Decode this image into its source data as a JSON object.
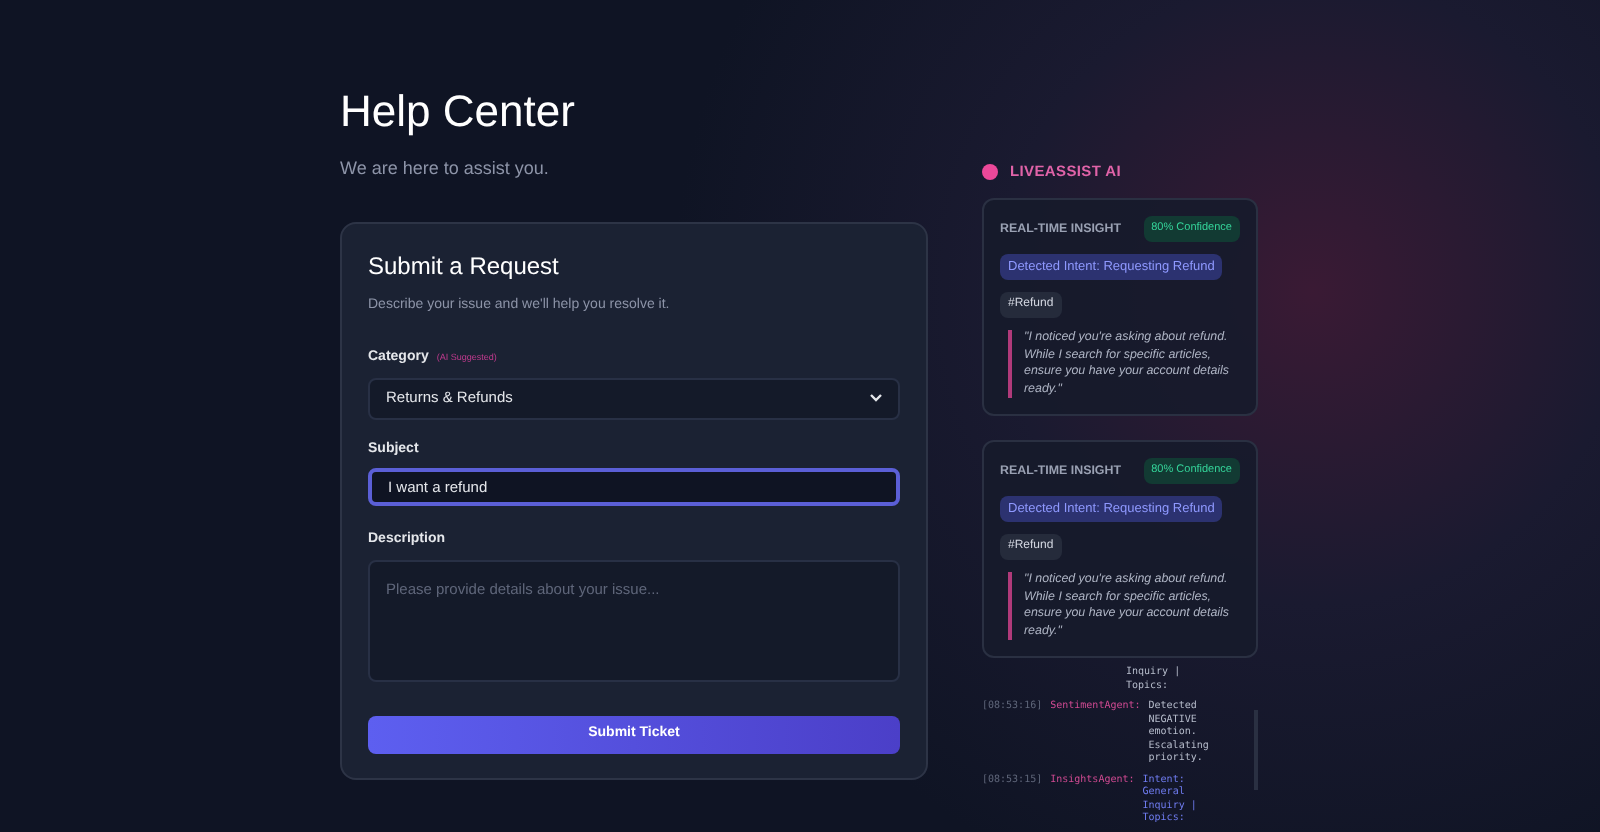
{
  "header": {
    "title": "Help Center",
    "subtitle": "We are here to assist you."
  },
  "form": {
    "title": "Submit a Request",
    "description": "Describe your issue and we'll help you resolve it.",
    "category": {
      "label": "Category",
      "hint": "(AI Suggested)",
      "value": "Returns & Refunds"
    },
    "subject": {
      "label": "Subject",
      "value": "I want a refund"
    },
    "description_field": {
      "label": "Description",
      "placeholder": "Please provide details about your issue..."
    },
    "submit": "Submit Ticket"
  },
  "assistant": {
    "title": "LIVEASSIST AI",
    "insights": [
      {
        "heading": "REAL-TIME INSIGHT",
        "confidence": "80% Confidence",
        "intent": "Detected Intent: Requesting Refund",
        "tag": "#Refund",
        "quote": "\"I noticed you're asking about refund. While I search for specific articles, ensure you have your account details ready.\""
      },
      {
        "heading": "REAL-TIME INSIGHT",
        "confidence": "80% Confidence",
        "intent": "Detected Intent: Requesting Refund",
        "tag": "#Refund",
        "quote": "\"I noticed you're asking about refund. While I search for specific articles, ensure you have your account details ready.\""
      }
    ],
    "log": [
      {
        "kind": "partial",
        "message": "Inquiry | Topics:"
      },
      {
        "kind": "sentiment",
        "time": "[08:53:16]",
        "agent": "SentimentAgent:",
        "message": "Detected NEGATIVE emotion. Escalating priority."
      },
      {
        "kind": "insights",
        "time": "[08:53:15]",
        "agent": "InsightsAgent:",
        "message": "Intent: General Inquiry | Topics:"
      }
    ]
  }
}
